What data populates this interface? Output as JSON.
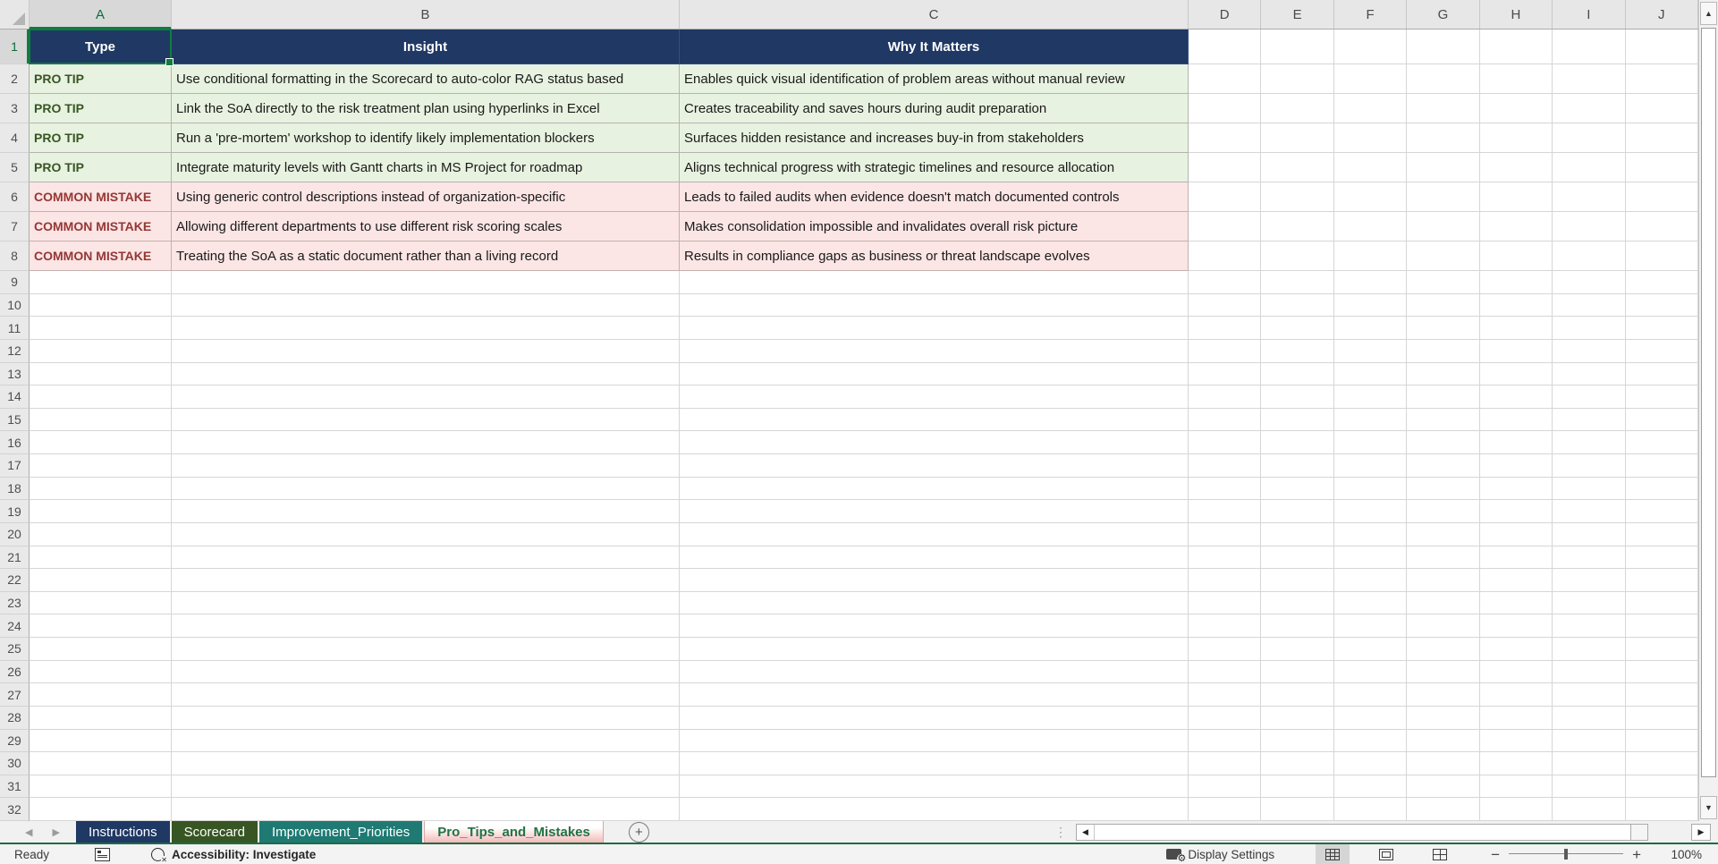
{
  "columns": [
    "A",
    "B",
    "C",
    "D",
    "E",
    "F",
    "G",
    "H",
    "I",
    "J"
  ],
  "visible_row_count": 32,
  "selection": {
    "cell": "A1",
    "column": "A",
    "row": 1
  },
  "table": {
    "headers": [
      "Type",
      "Insight",
      "Why It Matters"
    ],
    "rows": [
      {
        "kind": "tip",
        "type": "PRO TIP",
        "insight": "Use conditional formatting in the Scorecard to auto-color RAG status based",
        "why_it_matters": "Enables quick visual identification of problem areas without manual review"
      },
      {
        "kind": "tip",
        "type": "PRO TIP",
        "insight": "Link the SoA directly to the risk treatment plan using hyperlinks in Excel",
        "why_it_matters": "Creates traceability and saves hours during audit preparation"
      },
      {
        "kind": "tip",
        "type": "PRO TIP",
        "insight": "Run a 'pre-mortem' workshop to identify likely implementation blockers",
        "why_it_matters": "Surfaces hidden resistance and increases buy-in from stakeholders"
      },
      {
        "kind": "tip",
        "type": "PRO TIP",
        "insight": "Integrate maturity levels with Gantt charts in MS Project for roadmap",
        "why_it_matters": "Aligns technical progress with strategic timelines and resource allocation"
      },
      {
        "kind": "mistake",
        "type": "COMMON MISTAKE",
        "insight": "Using generic control descriptions instead of organization-specific",
        "why_it_matters": "Leads to failed audits when evidence doesn't match documented controls"
      },
      {
        "kind": "mistake",
        "type": "COMMON MISTAKE",
        "insight": "Allowing different departments to use different risk scoring scales",
        "why_it_matters": "Makes consolidation impossible and invalidates overall risk picture"
      },
      {
        "kind": "mistake",
        "type": "COMMON MISTAKE",
        "insight": "Treating the SoA as a static document rather than a living record",
        "why_it_matters": "Results in compliance gaps as business or threat landscape evolves"
      }
    ]
  },
  "sheet_tabs": [
    {
      "label": "Instructions",
      "color": "#1F3864",
      "text_color": "#FFFFFF",
      "active": false
    },
    {
      "label": "Scorecard",
      "color": "#375623",
      "text_color": "#FFFFFF",
      "active": false
    },
    {
      "label": "Improvement_Priorities",
      "color": "#1E7A73",
      "text_color": "#FFFFFF",
      "active": false
    },
    {
      "label": "Pro_Tips_and_Mistakes",
      "color": "#F3BAB8",
      "text_color": "#217346",
      "active": true
    }
  ],
  "tab_bar": {
    "add_sheet_icon": "+",
    "prev_icon": "◀",
    "next_icon": "▶",
    "grip_icon": "⋮"
  },
  "scrollbars": {
    "up_icon": "▲",
    "down_icon": "▼",
    "left_icon": "◀",
    "right_icon": "▶"
  },
  "status_bar": {
    "ready_label": "Ready",
    "accessibility_label": "Accessibility: Investigate",
    "display_settings_label": "Display Settings",
    "zoom_out_label": "−",
    "zoom_in_label": "+",
    "zoom_level": "100%"
  },
  "colors": {
    "header_fill": "#1F3864",
    "header_text": "#FFFFFF",
    "tip_fill": "#E8F2E0",
    "tip_text": "#375623",
    "mistake_fill": "#FBE5E5",
    "mistake_text": "#953735",
    "selection_green": "#107C41",
    "active_tab_text": "#217346"
  }
}
